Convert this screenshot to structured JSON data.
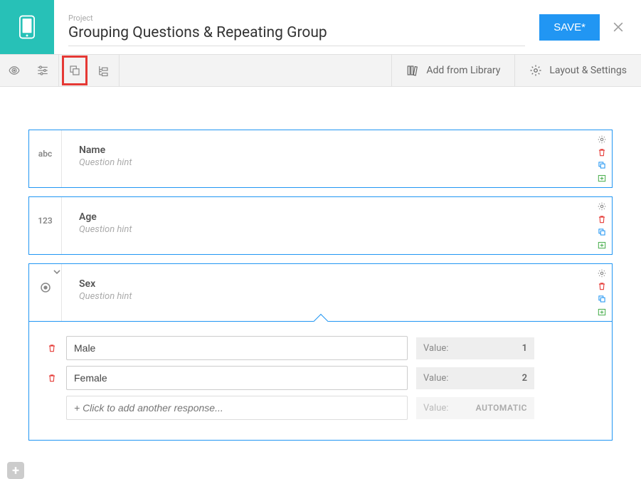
{
  "header": {
    "project_label": "Project",
    "project_title": "Grouping Questions & Repeating Group",
    "save_label": "SAVE*"
  },
  "toolbar": {
    "add_library_label": "Add from Library",
    "layout_settings_label": "Layout & Settings"
  },
  "questions": [
    {
      "type_label": "abc",
      "label": "Name",
      "hint": "Question hint"
    },
    {
      "type_label": "123",
      "label": "Age",
      "hint": "Question hint"
    },
    {
      "type_label": "select",
      "label": "Sex",
      "hint": "Question hint"
    }
  ],
  "options": {
    "value_label": "Value:",
    "rows": [
      {
        "label": "Male",
        "value": "1"
      },
      {
        "label": "Female",
        "value": "2"
      }
    ],
    "add_placeholder": "+ Click to add another response...",
    "auto_value": "AUTOMATIC"
  }
}
